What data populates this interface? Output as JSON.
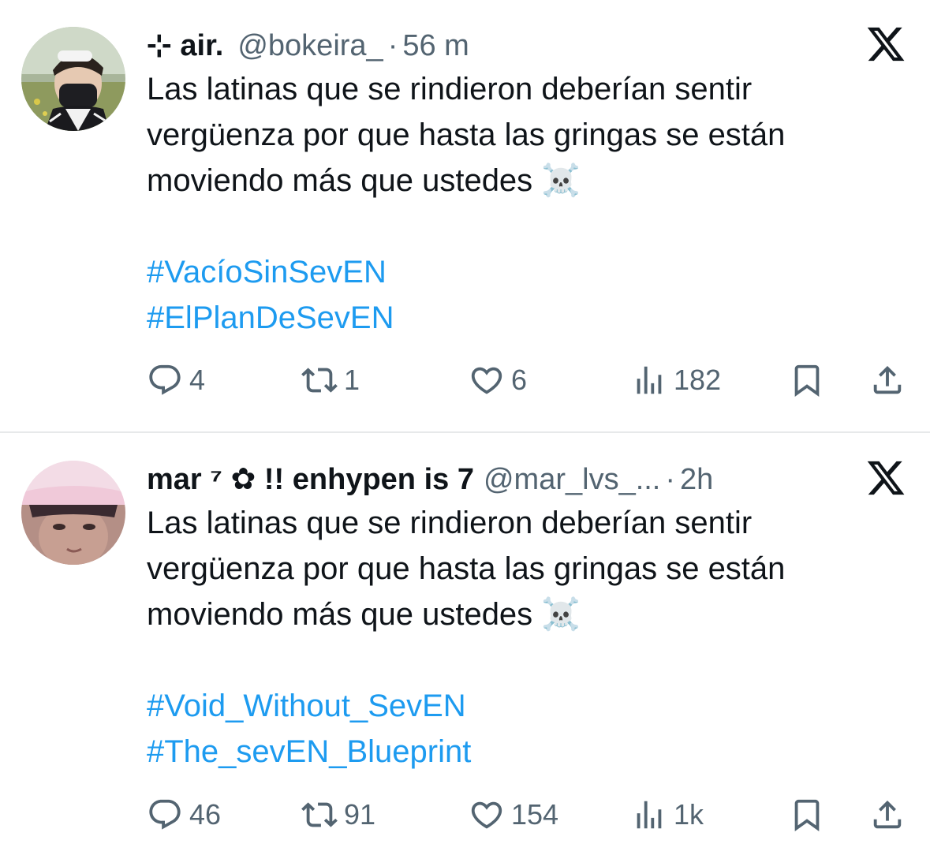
{
  "tweets": [
    {
      "display_name": "⊹ air.",
      "handle": "@bokeira_",
      "separator": "·",
      "time": "56 m",
      "text_lines": [
        "Las latinas que se rindieron deberían sentir",
        "vergüenza por que hasta las gringas se están",
        "moviendo más que ustedes ☠️"
      ],
      "hashtags": [
        "#VacíoSinSevEN",
        "#ElPlanDeSevEN"
      ],
      "stats": {
        "replies": "4",
        "reposts": "1",
        "likes": "6",
        "views": "182"
      }
    },
    {
      "display_name": "mar ⁷ ✿ !! enhypen is 7",
      "handle": "@mar_lvs_...",
      "separator": "·",
      "time": "2h",
      "text_lines": [
        "Las latinas que se rindieron deberían sentir",
        "vergüenza por que hasta las gringas se están",
        "moviendo más que ustedes ☠️"
      ],
      "hashtags": [
        "#Void_Without_SevEN",
        "#The_sevEN_Blueprint"
      ],
      "stats": {
        "replies": "46",
        "reposts": "91",
        "likes": "154",
        "views": "1k"
      }
    }
  ],
  "icons": {
    "platform": "x-logo-icon",
    "reply": "reply-icon",
    "repost": "repost-icon",
    "like": "heart-icon",
    "views": "views-icon",
    "bookmark": "bookmark-icon",
    "share": "share-icon"
  },
  "colors": {
    "text": "#0f1419",
    "secondary": "#536471",
    "hashtag": "#1d9bf0",
    "divider": "#e7e9ea"
  }
}
